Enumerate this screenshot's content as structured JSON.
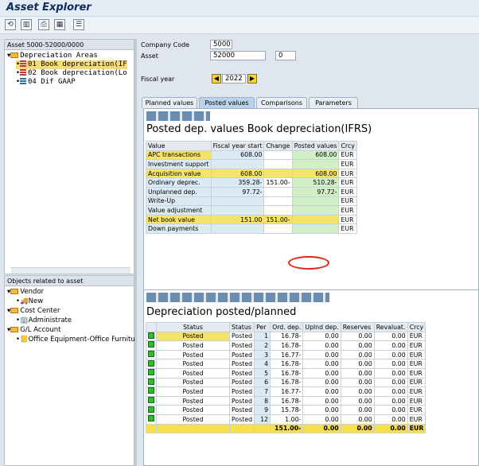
{
  "app": {
    "title": "Asset Explorer"
  },
  "toolbar": [
    "⟲",
    "▥",
    "⎙",
    "▦",
    "☰"
  ],
  "left": {
    "header": "Asset 5000-52000/0000",
    "tree": [
      {
        "label": "Depreciation Areas",
        "level": 0,
        "icon": "folder"
      },
      {
        "label": "01 Book depreciation(IF",
        "level": 1,
        "icon": "area",
        "selected": true
      },
      {
        "label": "02 Book depreciation(Lo",
        "level": 1,
        "icon": "area"
      },
      {
        "label": "04 Dif GAAP",
        "level": 1,
        "icon": "area-alt"
      }
    ],
    "objects_header": "Objects related to asset",
    "objects": [
      {
        "label": "Vendor",
        "level": 0,
        "icon": "folder"
      },
      {
        "label": "New",
        "level": 1,
        "icon": "truck"
      },
      {
        "label": "Cost Center",
        "level": 0,
        "icon": "folder"
      },
      {
        "label": "Administrate",
        "level": 1,
        "icon": "costcenter"
      },
      {
        "label": "G/L Account",
        "level": 0,
        "icon": "folder"
      },
      {
        "label": "Office Equipment-Office Furniture",
        "level": 1,
        "icon": "account"
      }
    ]
  },
  "form": {
    "company_code_label": "Company Code",
    "company_code": "5000",
    "asset_label": "Asset",
    "asset": "52000",
    "subnumber": "0",
    "fiscal_year_label": "Fiscal year",
    "fiscal_year": "2022"
  },
  "tabs": [
    "Planned values",
    "Posted values",
    "Comparisons",
    "Parameters"
  ],
  "posted": {
    "title": "Posted dep. values Book depreciation(IFRS)",
    "headers": [
      "Value",
      "Fiscal year start",
      "Change",
      "Posted values",
      "Crcy"
    ],
    "rows": [
      [
        "APC transactions",
        "608.00",
        "",
        "608.00",
        "EUR"
      ],
      [
        "Investment support",
        "",
        "",
        "",
        "EUR"
      ],
      [
        "Acquisition value",
        "608.00",
        "",
        "608.00",
        "EUR"
      ],
      [
        "Ordinary deprec.",
        "359.28-",
        "151.00-",
        "510.28-",
        "EUR"
      ],
      [
        "Unplanned dep.",
        "97.72-",
        "",
        "97.72-",
        "EUR"
      ],
      [
        "Write-Up",
        "",
        "",
        "",
        "EUR"
      ],
      [
        "Value adjustment",
        "",
        "",
        "",
        "EUR"
      ],
      [
        "Net book value",
        "151.00",
        "151.00-",
        "",
        "EUR"
      ],
      [
        "Down payments",
        "",
        "",
        "",
        "EUR"
      ]
    ]
  },
  "depr": {
    "title": "Depreciation posted/planned",
    "headers": [
      "Status",
      "Status",
      "Per",
      "Ord. dep.",
      "Uplnd dep.",
      "Reserves",
      "Revaluat.",
      "Crcy"
    ],
    "rows": [
      [
        "Posted",
        "Posted",
        "1",
        "16.78-",
        "0.00",
        "0.00",
        "0.00",
        "EUR"
      ],
      [
        "Posted",
        "Posted",
        "2",
        "16.78-",
        "0.00",
        "0.00",
        "0.00",
        "EUR"
      ],
      [
        "Posted",
        "Posted",
        "3",
        "16.77-",
        "0.00",
        "0.00",
        "0.00",
        "EUR"
      ],
      [
        "Posted",
        "Posted",
        "4",
        "16.78-",
        "0.00",
        "0.00",
        "0.00",
        "EUR"
      ],
      [
        "Posted",
        "Posted",
        "5",
        "16.78-",
        "0.00",
        "0.00",
        "0.00",
        "EUR"
      ],
      [
        "Posted",
        "Posted",
        "6",
        "16.78-",
        "0.00",
        "0.00",
        "0.00",
        "EUR"
      ],
      [
        "Posted",
        "Posted",
        "7",
        "16.77-",
        "0.00",
        "0.00",
        "0.00",
        "EUR"
      ],
      [
        "Posted",
        "Posted",
        "8",
        "16.78-",
        "0.00",
        "0.00",
        "0.00",
        "EUR"
      ],
      [
        "Posted",
        "Posted",
        "9",
        "15.78-",
        "0.00",
        "0.00",
        "0.00",
        "EUR"
      ],
      [
        "Posted",
        "Posted",
        "12",
        "1.00-",
        "0.00",
        "0.00",
        "0.00",
        "EUR"
      ]
    ],
    "total": [
      "",
      "",
      "",
      "151.00-",
      "0.00",
      "0.00",
      "0.00",
      "EUR"
    ]
  }
}
